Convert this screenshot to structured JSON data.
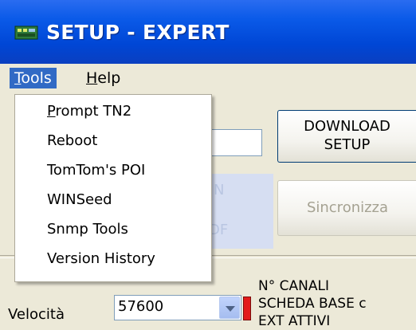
{
  "window": {
    "title": "SETUP - EXPERT"
  },
  "menubar": {
    "tools": "Tools",
    "help": "Help"
  },
  "tools_menu": {
    "items": [
      "Prompt TN2",
      "Reboot",
      "TomTom's POI",
      "WINSeed",
      "Snmp Tools",
      "Version History"
    ]
  },
  "buttons": {
    "download_line1": "DOWNLOAD",
    "download_line2": "SETUP",
    "sync": "Sincronizza"
  },
  "faded": {
    "n": "N",
    "off": "DF"
  },
  "velocita": {
    "label": "Velocità",
    "value": "57600"
  },
  "canali": {
    "line1": "N° CANALI",
    "line2": "SCHEDA BASE c",
    "line3": "EXT ATTIVI"
  },
  "colors": {
    "title_bar": "#0a5ae8",
    "menu_highlight": "#316ac5",
    "indicator": "#e31b1b"
  }
}
